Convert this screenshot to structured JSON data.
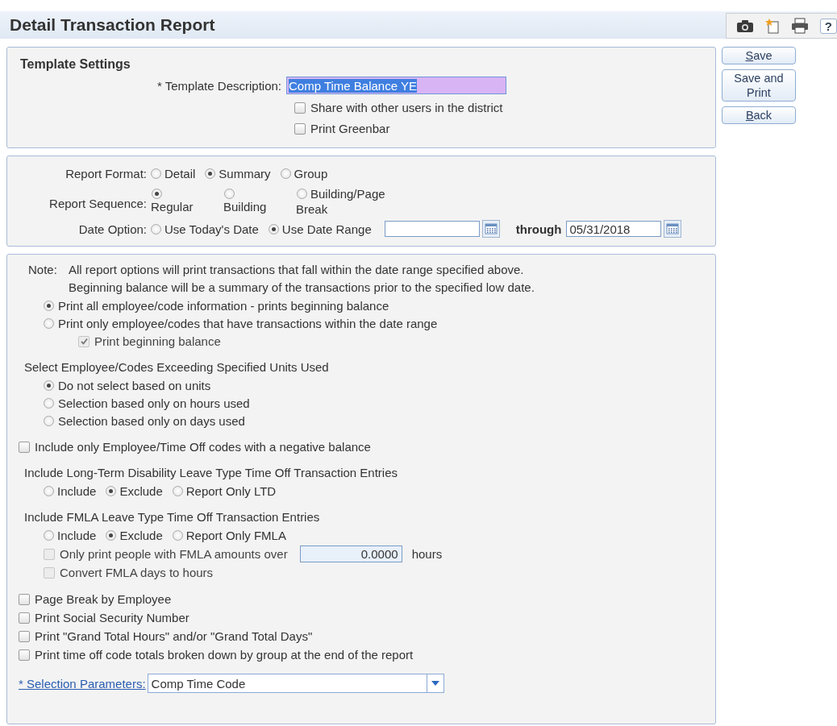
{
  "window": {
    "title": "Detail Transaction Report"
  },
  "toolbar": {
    "help_label": "?"
  },
  "actions": [
    {
      "label": "Save",
      "underline_first": true
    },
    {
      "label": "Save and Print",
      "underline_first": false
    },
    {
      "label": "Back",
      "underline_first": true
    }
  ],
  "template_settings": {
    "heading": "Template Settings",
    "description": {
      "label": "* Template Description:",
      "value": "Comp Time Balance YE",
      "selected": true
    },
    "options": [
      {
        "label": "Share with other users in the district",
        "checked": false
      },
      {
        "label": "Print Greenbar",
        "checked": false
      }
    ]
  },
  "format": {
    "rows": [
      {
        "kind": "inline",
        "label": "Report Format:",
        "options": [
          {
            "label": "Detail",
            "selected": false
          },
          {
            "label": "Summary",
            "selected": true
          },
          {
            "label": "Group",
            "selected": false
          }
        ]
      },
      {
        "kind": "stacked",
        "label": "Report Sequence:",
        "options": [
          {
            "label": "Regular",
            "selected": true
          },
          {
            "label": "Building",
            "selected": false
          },
          {
            "label": "Building/Page Break",
            "selected": false
          }
        ]
      },
      {
        "kind": "date",
        "label": "Date Option:",
        "options": [
          {
            "label": "Use Today's Date",
            "selected": false
          },
          {
            "label": "Use Date Range",
            "selected": true
          }
        ],
        "through_label": "through",
        "to_date": "05/31/2018"
      }
    ]
  },
  "options": {
    "items": [
      {
        "kind": "note",
        "label": "Note:",
        "lines": [
          "All report options will print transactions that fall within the date range specified above.",
          "Beginning balance will be a summary of the transactions prior to the specified low date."
        ]
      },
      {
        "kind": "list",
        "options": [
          {
            "label": "Print all employee/code information - prints beginning balance",
            "selected": true
          },
          {
            "label": "Print only employee/codes that have transactions within the date range",
            "selected": false,
            "children": [
              {
                "label": "Print beginning balance",
                "checked": true,
                "disabled": true
              }
            ]
          }
        ]
      },
      {
        "kind": "list",
        "heading": "Select Employee/Codes Exceeding Specified Units Used",
        "options": [
          {
            "label": "Do not select based on units",
            "selected": true
          },
          {
            "label": "Selection based only on hours used",
            "selected": false
          },
          {
            "label": "Selection based only on days used",
            "selected": false
          }
        ]
      },
      {
        "kind": "checkbox",
        "label": "Include only Employee/Time Off codes with a negative balance",
        "checked": false
      },
      {
        "kind": "inline",
        "heading": "Include Long-Term Disability Leave Type Time Off Transaction Entries",
        "options": [
          {
            "label": "Include",
            "selected": false
          },
          {
            "label": "Exclude",
            "selected": true
          },
          {
            "label": "Report Only LTD",
            "selected": false
          }
        ]
      },
      {
        "kind": "inline",
        "heading": "Include FMLA Leave Type Time Off Transaction Entries",
        "options": [
          {
            "label": "Include",
            "selected": false
          },
          {
            "label": "Exclude",
            "selected": true
          },
          {
            "label": "Report Only FMLA",
            "selected": false
          }
        ],
        "extras": [
          {
            "kind": "amount",
            "label": "Only print people with FMLA amounts over",
            "checked": false,
            "disabled": true,
            "value": "0.0000",
            "unit": "hours"
          },
          {
            "kind": "checkbox",
            "label": "Convert FMLA days to hours",
            "checked": false,
            "disabled": true
          }
        ]
      },
      {
        "kind": "checkbox",
        "label": "Page Break by Employee",
        "checked": false
      },
      {
        "kind": "checkbox",
        "label": "Print Social Security Number",
        "checked": false
      },
      {
        "kind": "checkbox",
        "label": "Print \"Grand Total Hours\" and/or \"Grand Total Days\"",
        "checked": false
      },
      {
        "kind": "checkbox",
        "label": "Print time off code totals broken down by group at the end of the report",
        "checked": false
      },
      {
        "kind": "select",
        "label": "* Selection Parameters:",
        "value": "Comp Time Code"
      }
    ]
  }
}
